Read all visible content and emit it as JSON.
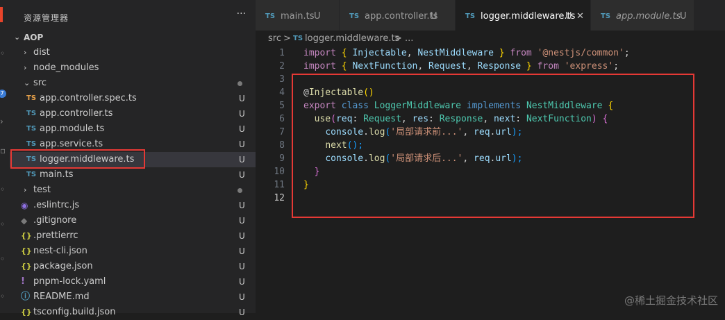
{
  "explorer": {
    "title": "资源管理器",
    "more": "···",
    "project": "AOP",
    "items": [
      {
        "name": "dist",
        "type": "folder",
        "badge": ""
      },
      {
        "name": "node_modules",
        "type": "folder",
        "badge": ""
      },
      {
        "name": "src",
        "type": "folder-open",
        "badge": "dot"
      },
      {
        "name": "app.controller.spec.ts",
        "type": "ts-spec",
        "badge": "U"
      },
      {
        "name": "app.controller.ts",
        "type": "ts",
        "badge": "U"
      },
      {
        "name": "app.module.ts",
        "type": "ts",
        "badge": "U"
      },
      {
        "name": "app.service.ts",
        "type": "ts",
        "badge": "U"
      },
      {
        "name": "logger.middleware.ts",
        "type": "ts",
        "badge": "U"
      },
      {
        "name": "main.ts",
        "type": "ts",
        "badge": "U"
      },
      {
        "name": "test",
        "type": "folder",
        "badge": "dot"
      },
      {
        "name": ".eslintrc.js",
        "type": "eslint",
        "badge": "U"
      },
      {
        "name": ".gitignore",
        "type": "git",
        "badge": "U"
      },
      {
        "name": ".prettierrc",
        "type": "json",
        "badge": "U"
      },
      {
        "name": "nest-cli.json",
        "type": "json",
        "badge": "U"
      },
      {
        "name": "package.json",
        "type": "json",
        "badge": "U"
      },
      {
        "name": "pnpm-lock.yaml",
        "type": "yaml",
        "badge": "U"
      },
      {
        "name": "README.md",
        "type": "info",
        "badge": "U"
      },
      {
        "name": "tsconfig.build.json",
        "type": "json",
        "badge": "U"
      }
    ],
    "file_icon_ts": "TS",
    "badge_untracked": "U",
    "icons": {
      "folder_closed": "chevron-right-icon",
      "folder_open": "chevron-down-icon"
    }
  },
  "activity_bar": {
    "badge": "7"
  },
  "tabs": [
    {
      "icon": "TS",
      "label": "main.ts",
      "badge": "U",
      "active": false,
      "italic": false
    },
    {
      "icon": "TS",
      "label": "app.controller.ts",
      "badge": "U",
      "active": false,
      "italic": false
    },
    {
      "icon": "TS",
      "label": "logger.middleware.ts",
      "badge": "U",
      "active": true,
      "italic": false,
      "close": "✕"
    },
    {
      "icon": "TS",
      "label": "app.module.ts",
      "badge": "U",
      "active": false,
      "italic": true
    }
  ],
  "breadcrumb": {
    "folder": "src",
    "sep": ">",
    "icon": "TS",
    "file": "logger.middleware.ts",
    "tail": "> ..."
  },
  "editor": {
    "line_numbers": [
      "1",
      "2",
      "3",
      "4",
      "5",
      "6",
      "7",
      "8",
      "9",
      "10",
      "11",
      "12"
    ],
    "current_line": "12",
    "lines": [
      [
        {
          "t": "import",
          "c": "kw"
        },
        {
          "t": " { ",
          "c": "b1"
        },
        {
          "t": "Injectable",
          "c": "var"
        },
        {
          "t": ", ",
          "c": ""
        },
        {
          "t": "NestMiddleware",
          "c": "var"
        },
        {
          "t": " } ",
          "c": "b1"
        },
        {
          "t": "from",
          "c": "kw"
        },
        {
          "t": " ",
          "c": ""
        },
        {
          "t": "'@nestjs/common'",
          "c": "str"
        },
        {
          "t": ";",
          "c": ""
        }
      ],
      [
        {
          "t": "import",
          "c": "kw"
        },
        {
          "t": " { ",
          "c": "b1"
        },
        {
          "t": "NextFunction",
          "c": "var"
        },
        {
          "t": ", ",
          "c": ""
        },
        {
          "t": "Request",
          "c": "var"
        },
        {
          "t": ", ",
          "c": ""
        },
        {
          "t": "Response",
          "c": "var"
        },
        {
          "t": " } ",
          "c": "b1"
        },
        {
          "t": "from",
          "c": "kw"
        },
        {
          "t": " ",
          "c": ""
        },
        {
          "t": "'express'",
          "c": "str"
        },
        {
          "t": ";",
          "c": ""
        }
      ],
      [],
      [
        {
          "t": "@",
          "c": ""
        },
        {
          "t": "Injectable",
          "c": "fn"
        },
        {
          "t": "()",
          "c": "b1"
        }
      ],
      [
        {
          "t": "export",
          "c": "kw"
        },
        {
          "t": " ",
          "c": ""
        },
        {
          "t": "class",
          "c": "kwb"
        },
        {
          "t": " ",
          "c": ""
        },
        {
          "t": "LoggerMiddleware",
          "c": "cls"
        },
        {
          "t": " ",
          "c": ""
        },
        {
          "t": "implements",
          "c": "kwb"
        },
        {
          "t": " ",
          "c": ""
        },
        {
          "t": "NestMiddleware",
          "c": "cls"
        },
        {
          "t": " {",
          "c": "b1"
        }
      ],
      [
        {
          "t": "  ",
          "c": ""
        },
        {
          "t": "use",
          "c": "fn"
        },
        {
          "t": "(",
          "c": "b2"
        },
        {
          "t": "req",
          "c": "var"
        },
        {
          "t": ": ",
          "c": ""
        },
        {
          "t": "Request",
          "c": "cls"
        },
        {
          "t": ", ",
          "c": ""
        },
        {
          "t": "res",
          "c": "var"
        },
        {
          "t": ": ",
          "c": ""
        },
        {
          "t": "Response",
          "c": "cls"
        },
        {
          "t": ", ",
          "c": ""
        },
        {
          "t": "next",
          "c": "var"
        },
        {
          "t": ": ",
          "c": ""
        },
        {
          "t": "NextFunction",
          "c": "cls"
        },
        {
          "t": ") {",
          "c": "b2"
        }
      ],
      [
        {
          "t": "    ",
          "c": ""
        },
        {
          "t": "console",
          "c": "var"
        },
        {
          "t": ".",
          "c": ""
        },
        {
          "t": "log",
          "c": "fn"
        },
        {
          "t": "(",
          "c": "b3"
        },
        {
          "t": "'局部请求前...'",
          "c": "str"
        },
        {
          "t": ", ",
          "c": ""
        },
        {
          "t": "req",
          "c": "var"
        },
        {
          "t": ".",
          "c": ""
        },
        {
          "t": "url",
          "c": "var"
        },
        {
          "t": ");",
          "c": "b3"
        }
      ],
      [
        {
          "t": "    ",
          "c": ""
        },
        {
          "t": "next",
          "c": "fn"
        },
        {
          "t": "();",
          "c": "b3"
        }
      ],
      [
        {
          "t": "    ",
          "c": ""
        },
        {
          "t": "console",
          "c": "var"
        },
        {
          "t": ".",
          "c": ""
        },
        {
          "t": "log",
          "c": "fn"
        },
        {
          "t": "(",
          "c": "b3"
        },
        {
          "t": "'局部请求后...'",
          "c": "str"
        },
        {
          "t": ", ",
          "c": ""
        },
        {
          "t": "req",
          "c": "var"
        },
        {
          "t": ".",
          "c": ""
        },
        {
          "t": "url",
          "c": "var"
        },
        {
          "t": ");",
          "c": "b3"
        }
      ],
      [
        {
          "t": "  }",
          "c": "b2"
        }
      ],
      [
        {
          "t": "}",
          "c": "b1"
        }
      ],
      []
    ]
  },
  "watermark": "@稀土掘金技术社区"
}
